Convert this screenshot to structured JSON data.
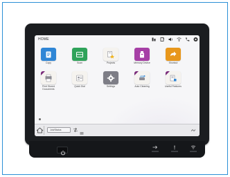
{
  "screen": {
    "title": "HOME"
  },
  "status_icons": [
    "ink-icon",
    "copy-status-icon",
    "speaker-icon",
    "network-icon",
    "phone-icon",
    "settings-icon"
  ],
  "apps": [
    {
      "label": "Copy",
      "icon": "copy-icon",
      "color": "#2f86d6"
    },
    {
      "label": "Scan",
      "icon": "scan-icon",
      "color": "#2fa35a"
    },
    {
      "label": "Projects",
      "icon": "projects-icon",
      "color": "#f5f3ef"
    },
    {
      "label": "Memory Device",
      "icon": "memory-device-icon",
      "color": "#a63fa6"
    },
    {
      "label": "Shortcut",
      "icon": "shortcut-icon",
      "color": "#e8971c"
    },
    {
      "label": "Print Stored Documents",
      "icon": "print-stored-icon",
      "color": "#f5f3ef"
    },
    {
      "label": "Quick Dial",
      "icon": "quick-dial-icon",
      "color": "#f5f3ef"
    },
    {
      "label": "Settings",
      "icon": "settings-gear-icon",
      "color": "#7d7d86"
    },
    {
      "label": "Auto Cleaning",
      "icon": "auto-cleaning-icon",
      "color": "#f5f3ef"
    },
    {
      "label": "Useful Features",
      "icon": "useful-features-icon",
      "color": "#f5f3ef"
    }
  ],
  "bottom_bar": {
    "job_status": "Job/Status"
  }
}
